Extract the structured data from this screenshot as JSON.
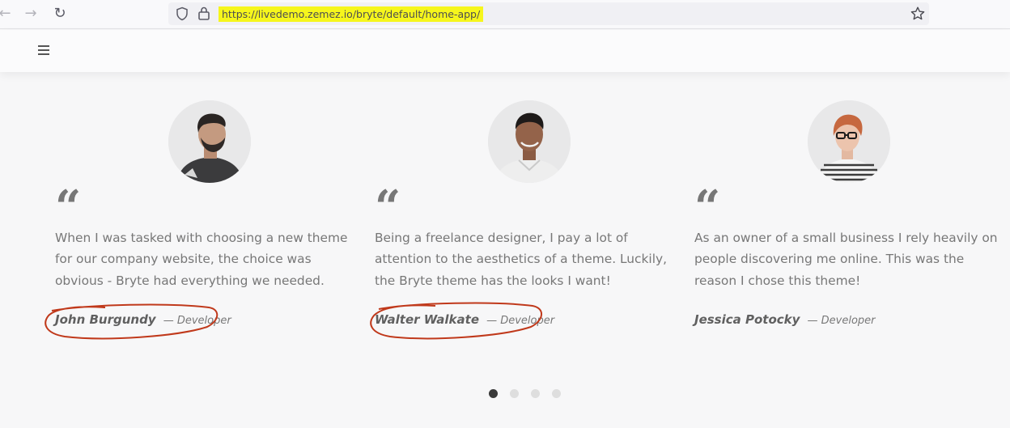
{
  "browser": {
    "url": "https://livedemo.zemez.io/bryte/default/home-app/",
    "back_glyph": "←",
    "forward_glyph": "→",
    "reload_glyph": "↻",
    "url_highlight_color": "#f6f61c"
  },
  "header": {
    "menu_icon": "hamburger-menu-icon"
  },
  "testimonials": [
    {
      "quote_mark": "“",
      "text": "When I was tasked with choosing a new theme for our company website, the choice was obvious - Bryte had everything we needed.",
      "name": "John Burgundy",
      "role": "— Developer",
      "circled": true
    },
    {
      "quote_mark": "“",
      "text": "Being a freelance designer, I pay a lot of attention to the aesthetics of a theme. Luckily, the Bryte theme has the looks I want!",
      "name": "Walter Walkate",
      "role": "— Developer",
      "circled": true
    },
    {
      "quote_mark": "“",
      "text": "As an owner of a small business I rely heavily on people discovering me online. This was the reason I chose this theme!",
      "name": "Jessica Potocky",
      "role": "— Developer",
      "circled": false
    }
  ],
  "pagination": {
    "count": 4,
    "active_index": 0
  },
  "colors": {
    "annotation_circle": "#c0391b",
    "dot_active": "#3a3a3a",
    "dot_inactive": "#dedede"
  }
}
